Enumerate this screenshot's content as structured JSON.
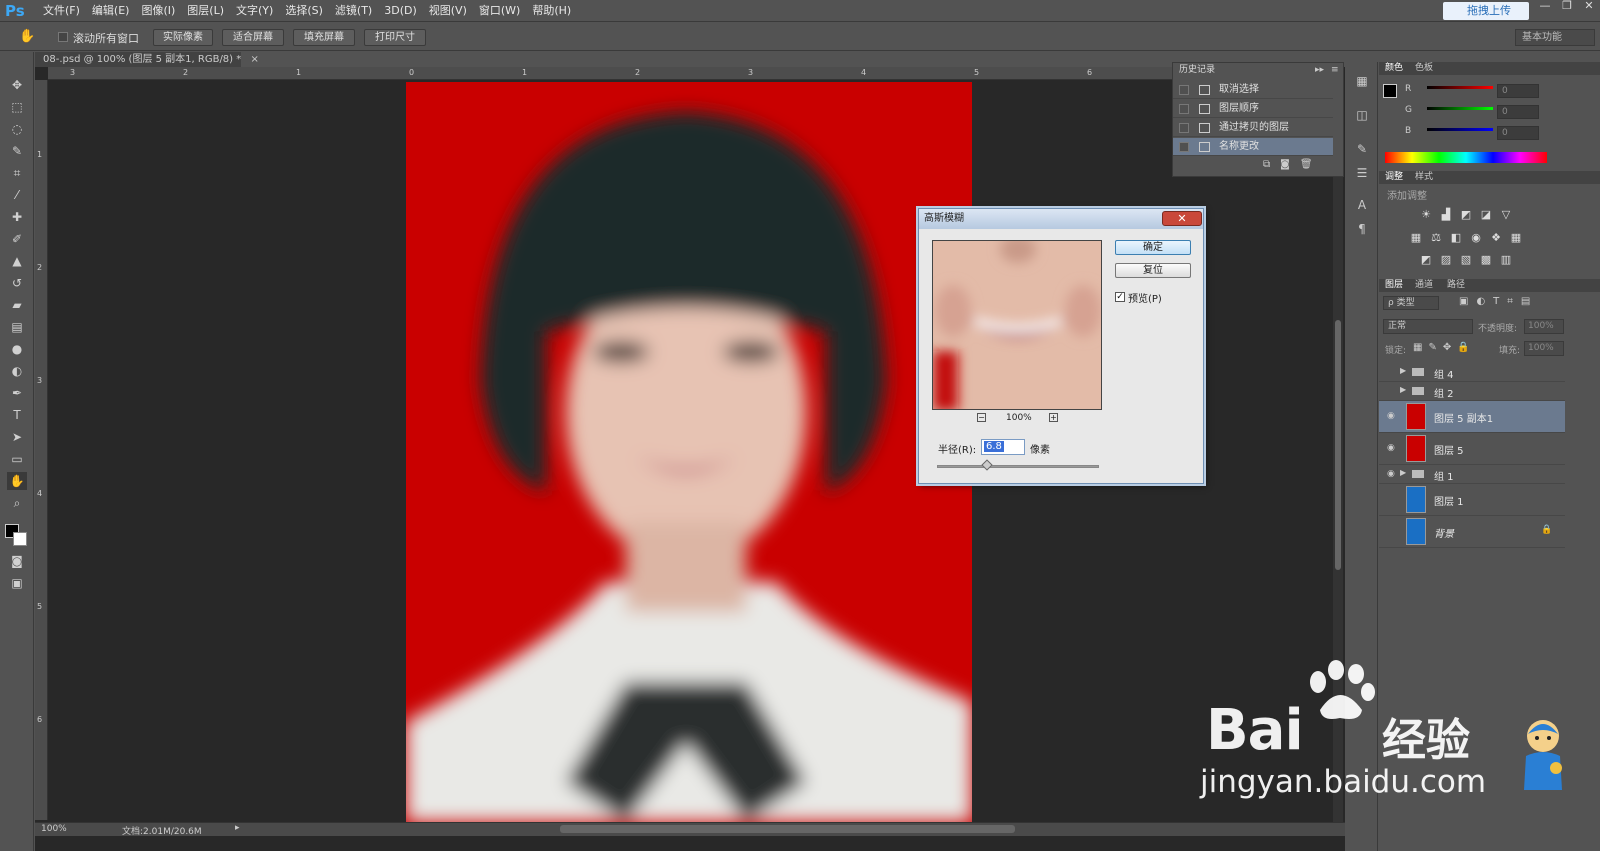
{
  "app": {
    "logo": "Ps"
  },
  "menubar": {
    "items": [
      "文件(F)",
      "编辑(E)",
      "图像(I)",
      "图层(L)",
      "文字(Y)",
      "选择(S)",
      "滤镜(T)",
      "3D(D)",
      "视图(V)",
      "窗口(W)",
      "帮助(H)"
    ],
    "upload_label": "拖拽上传",
    "window_buttons": [
      "—",
      "❐",
      "✕"
    ]
  },
  "options": {
    "scroll_all_label": "滚动所有窗口",
    "buttons": [
      "实际像素",
      "适合屏幕",
      "填充屏幕",
      "打印尺寸"
    ],
    "workspace": "基本功能"
  },
  "document": {
    "tab_title": "08-.psd @ 100% (图层 5 副本1, RGB/8) *",
    "tab_close": "×",
    "ruler_h": [
      "3",
      "2",
      "1",
      "0",
      "1",
      "2",
      "3",
      "4",
      "5",
      "6"
    ],
    "ruler_v": [
      "1",
      "2",
      "3",
      "4",
      "5",
      "6"
    ],
    "zoom": "100%",
    "doc_size": "文档:2.01M/20.6M"
  },
  "history": {
    "tab": "历史记录",
    "items": [
      "取消选择",
      "图层顺序",
      "通过拷贝的图层",
      "名称更改"
    ]
  },
  "color": {
    "tabs": [
      "颜色",
      "色板"
    ],
    "channels": [
      "R",
      "G",
      "B"
    ],
    "values": [
      "0",
      "0",
      "0"
    ]
  },
  "adjustments": {
    "tabs": [
      "调整",
      "样式"
    ],
    "title": "添加调整"
  },
  "layers": {
    "tabs": [
      "图层",
      "通道",
      "路径"
    ],
    "filter_kind": "ρ 类型",
    "blend_mode": "正常",
    "opacity_label": "不透明度:",
    "opacity_value": "100%",
    "lock_label": "锁定:",
    "fill_label": "填充:",
    "fill_value": "100%",
    "items": [
      {
        "name": "组 4",
        "type": "group",
        "visible": false
      },
      {
        "name": "组 2",
        "type": "group",
        "visible": false
      },
      {
        "name": "图层 5 副本1",
        "type": "layer",
        "visible": true,
        "selected": true
      },
      {
        "name": "图层 5",
        "type": "layer",
        "visible": true
      },
      {
        "name": "组 1",
        "type": "group",
        "visible": true
      },
      {
        "name": "图层 1",
        "type": "layer",
        "visible": false
      },
      {
        "name": "背景",
        "type": "background",
        "visible": false
      }
    ]
  },
  "dialog": {
    "title": "高斯模糊",
    "ok": "确定",
    "reset": "复位",
    "preview_label": "预览(P)",
    "zoom": "100%",
    "radius_label": "半径(R):",
    "radius_value": "6.8",
    "radius_unit": "像素"
  },
  "watermark": {
    "brand": "Bai",
    "suffix": "经验",
    "url": "jingyan.baidu.com"
  },
  "colors": {
    "bg": "#535353",
    "canvas_red": "#c90000",
    "accent": "#3da8f5"
  }
}
